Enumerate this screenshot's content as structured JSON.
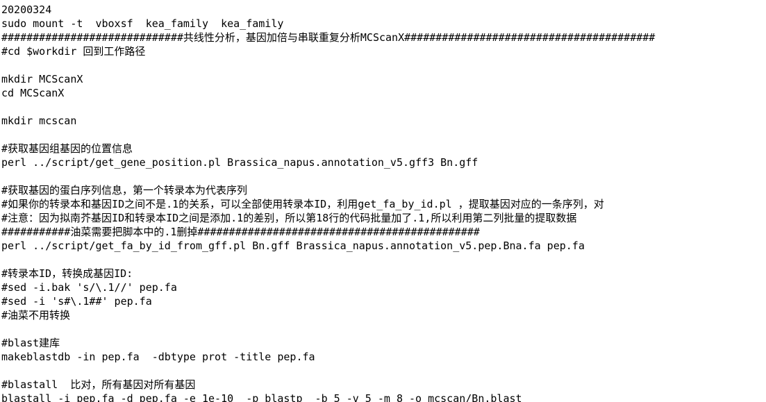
{
  "document": {
    "kind": "terminal-text-notes",
    "background_color": "#ffffff",
    "text_color": "#000000",
    "font_size_px": 15,
    "line_height_px": 20,
    "lines": [
      "20200324",
      "sudo mount -t  vboxsf  kea_family  kea_family",
      "#############################共线性分析，基因加倍与串联重复分析MCScanX########################################",
      "#cd $workdir 回到工作路径",
      "",
      "mkdir MCScanX",
      "cd MCScanX",
      "",
      "mkdir mcscan",
      "",
      "#获取基因组基因的位置信息",
      "perl ../script/get_gene_position.pl Brassica_napus.annotation_v5.gff3 Bn.gff",
      "",
      "#获取基因的蛋白序列信息，第一个转录本为代表序列",
      "#如果你的转录本和基因ID之间不是.1的关系，可以全部使用转录本ID，利用get_fa_by_id.pl ，提取基因对应的一条序列，对",
      "#注意：因为拟南芥基因ID和转录本ID之间是添加.1的差别，所以第18行的代码批量加了.1,所以利用第二列批量的提取数据",
      "###########油菜需要把脚本中的.1删掉#############################################",
      "perl ../script/get_fa_by_id_from_gff.pl Bn.gff Brassica_napus.annotation_v5.pep.Bna.fa pep.fa",
      "",
      "#转录本ID，转换成基因ID:",
      "#sed -i.bak 's/\\.1//' pep.fa",
      "#sed -i 's#\\.1##' pep.fa",
      "#油菜不用转换",
      "",
      "#blast建库",
      "makeblastdb -in pep.fa  -dbtype prot -title pep.fa",
      "",
      "#blastall  比对，所有基因对所有基因",
      "blastall -i pep.fa -d pep.fa -e 1e-10  -p blastp  -b 5 -v 5 -m 8 -o mcscan/Bn.blast"
    ]
  }
}
